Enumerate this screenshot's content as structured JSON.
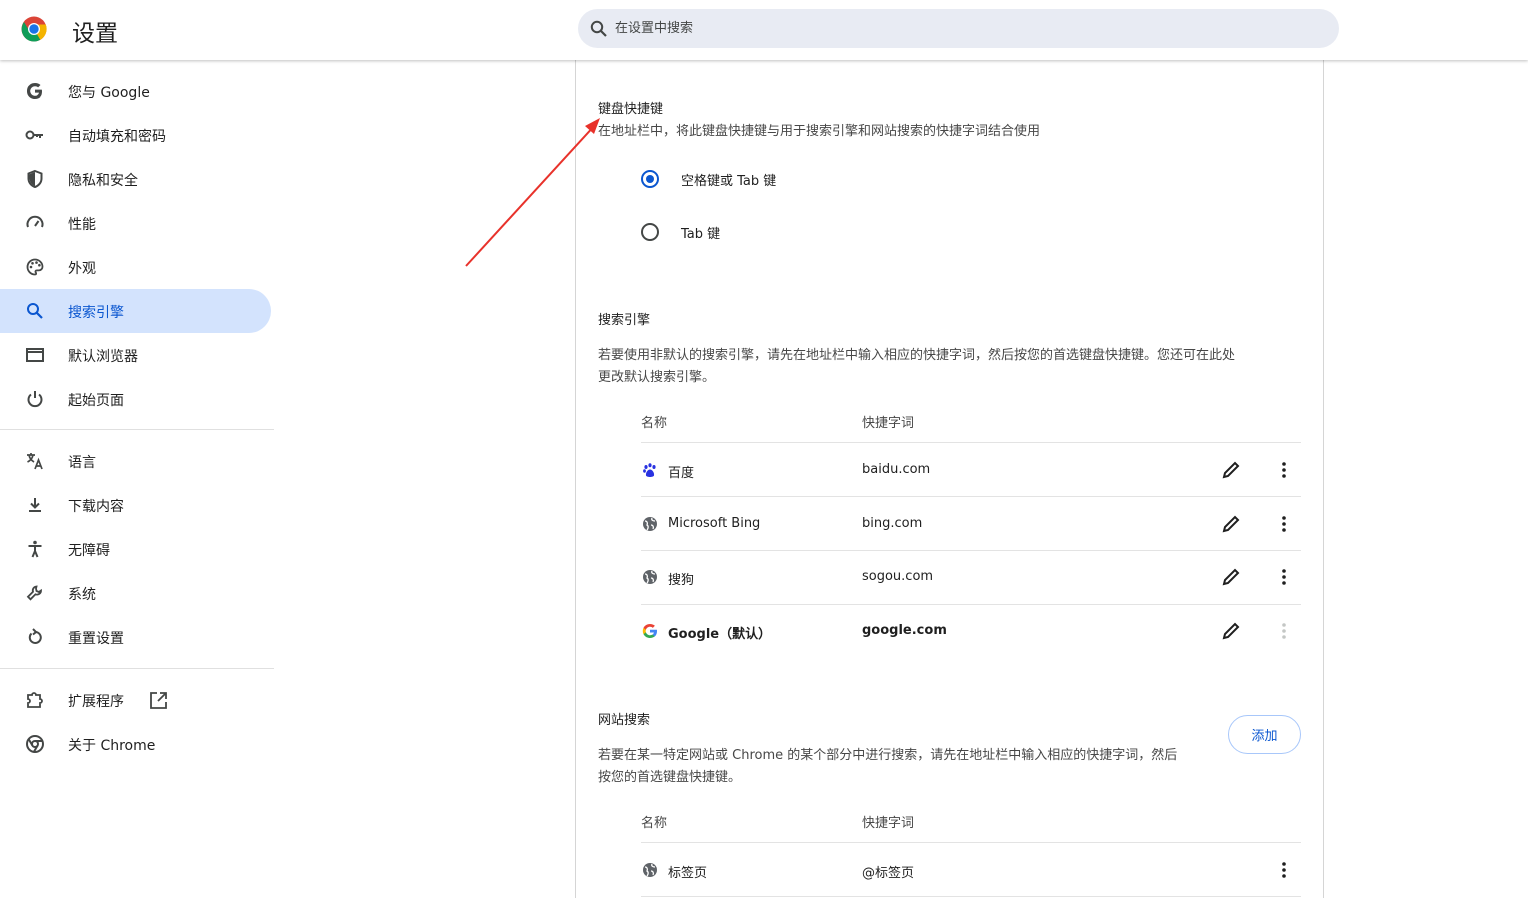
{
  "header": {
    "title": "设置",
    "search_placeholder": "在设置中搜索"
  },
  "sidebar": {
    "items": [
      {
        "label": "您与 Google",
        "icon": "google-g-icon"
      },
      {
        "label": "自动填充和密码",
        "icon": "key-icon"
      },
      {
        "label": "隐私和安全",
        "icon": "shield-icon"
      },
      {
        "label": "性能",
        "icon": "speedometer-icon"
      },
      {
        "label": "外观",
        "icon": "palette-icon"
      },
      {
        "label": "搜索引擎",
        "icon": "search-icon",
        "active": true
      },
      {
        "label": "默认浏览器",
        "icon": "browser-window-icon"
      },
      {
        "label": "起始页面",
        "icon": "power-icon"
      },
      {
        "label": "语言",
        "icon": "translate-icon"
      },
      {
        "label": "下载内容",
        "icon": "download-icon"
      },
      {
        "label": "无障碍",
        "icon": "accessibility-icon"
      },
      {
        "label": "系统",
        "icon": "wrench-icon"
      },
      {
        "label": "重置设置",
        "icon": "reset-icon"
      },
      {
        "label": "扩展程序",
        "icon": "puzzle-icon",
        "external_icon": "open-in-new-icon"
      },
      {
        "label": "关于 Chrome",
        "icon": "chrome-icon"
      }
    ]
  },
  "shortcut": {
    "title": "键盘快捷键",
    "description": "在地址栏中，将此键盘快捷键与用于搜索引擎和网站搜索的快捷字词结合使用",
    "options": [
      {
        "label": "空格键或 Tab 键",
        "selected": true
      },
      {
        "label": "Tab 键",
        "selected": false
      }
    ]
  },
  "engines": {
    "title": "搜索引擎",
    "description_line1": "若要使用非默认的搜索引擎，请先在地址栏中输入相应的快捷字词，然后按您的首选键盘快捷键。您还可在此处",
    "description_line2": "更改默认搜索引擎。",
    "col_name": "名称",
    "col_keyword": "快捷字词",
    "rows": [
      {
        "name": "百度",
        "keyword": "baidu.com",
        "icon": "baidu-paw-icon"
      },
      {
        "name": "Microsoft Bing",
        "keyword": "bing.com",
        "icon": "globe-icon"
      },
      {
        "name": "搜狗",
        "keyword": "sogou.com",
        "icon": "globe-icon"
      },
      {
        "name": "Google（默认）",
        "keyword": "google.com",
        "icon": "google-g-icon"
      }
    ]
  },
  "site_search": {
    "title": "网站搜索",
    "description_line1": "若要在某一特定网站或 Chrome 的某个部分中进行搜索，请先在地址栏中输入相应的快捷字词，然后",
    "description_line2": "按您的首选键盘快捷键。",
    "add_label": "添加",
    "col_name": "名称",
    "col_keyword": "快捷字词",
    "rows": [
      {
        "name": "标签页",
        "keyword": "@标签页",
        "icon": "globe-icon"
      }
    ]
  },
  "colors": {
    "accent": "#0b57d0",
    "active_bg": "#d3e3fd",
    "annotation_arrow": "#e8322b"
  }
}
